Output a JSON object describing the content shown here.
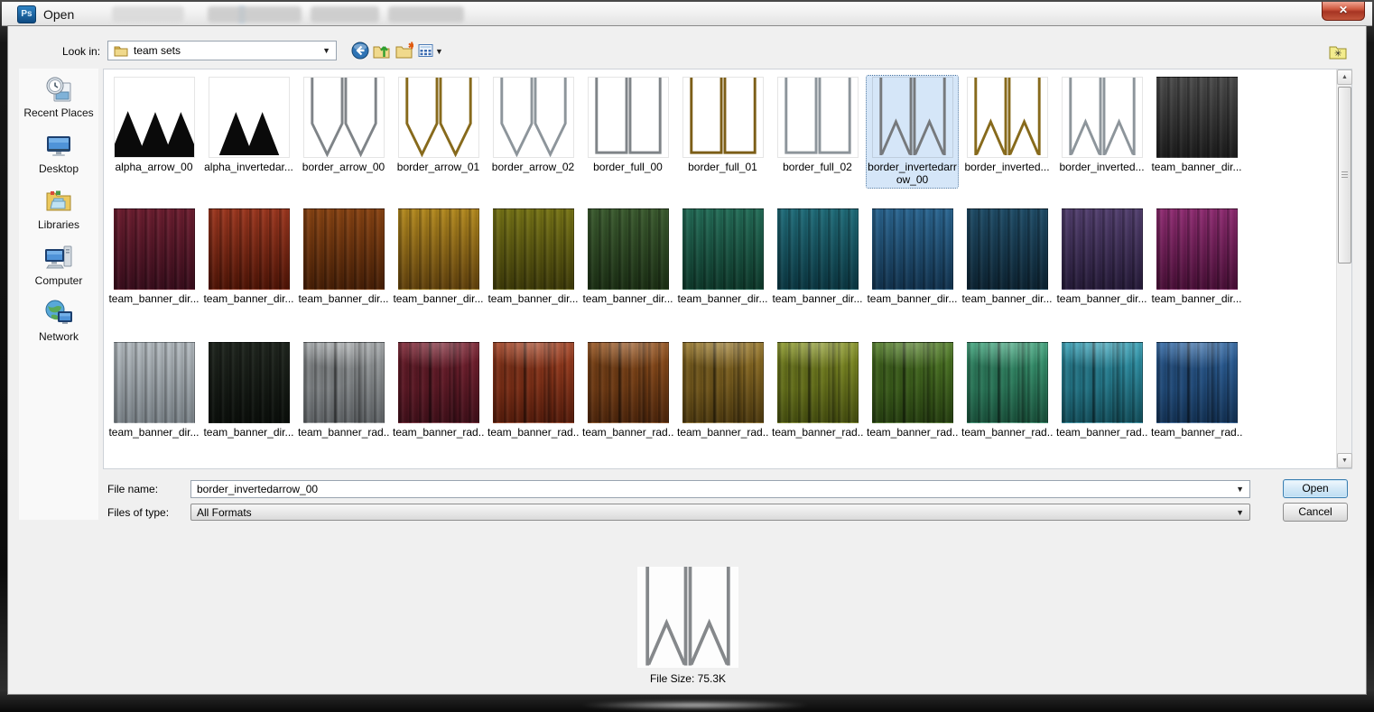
{
  "window": {
    "app_badge": "Ps",
    "title": "Open",
    "close_glyph": "✕"
  },
  "toolbar": {
    "look_in_label": "Look in:",
    "look_in_value": "team sets",
    "caret": "▼",
    "icons": [
      "back-icon",
      "up-one-level-icon",
      "new-folder-icon",
      "view-menu-icon",
      "favorites-icon"
    ]
  },
  "places": {
    "items": [
      "Recent Places",
      "Desktop",
      "Libraries",
      "Computer",
      "Network"
    ],
    "icons": [
      "recent-places-icon",
      "desktop-icon",
      "libraries-icon",
      "computer-icon",
      "network-icon"
    ]
  },
  "file_grid": {
    "rows": [
      {
        "items": [
          {
            "label": "alpha_arrow_00",
            "kind": "alpha3",
            "color": "#0a0a0a"
          },
          {
            "label": "alpha_invertedar...",
            "kind": "alpha2",
            "color": "#0a0a0a"
          },
          {
            "label": "border_arrow_00",
            "kind": "w",
            "color": "#7f8488"
          },
          {
            "label": "border_arrow_01",
            "kind": "w",
            "color": "#876a1c"
          },
          {
            "label": "border_arrow_02",
            "kind": "w",
            "color": "#8d959b"
          },
          {
            "label": "border_full_00",
            "kind": "u",
            "color": "#7f8488"
          },
          {
            "label": "border_full_01",
            "kind": "u",
            "color": "#7c5e17"
          },
          {
            "label": "border_full_02",
            "kind": "u",
            "color": "#8d959b"
          },
          {
            "label": "border_invertedarrow_00",
            "kind": "m",
            "color": "#76797c",
            "selected": true
          },
          {
            "label": "border_inverted...",
            "kind": "m",
            "color": "#876a1c"
          },
          {
            "label": "border_inverted...",
            "kind": "m",
            "color": "#8d959b"
          },
          {
            "label": "team_banner_dir...",
            "kind": "curtain-dir",
            "c1": "#4d4d4d",
            "c2": "#1d1d1d"
          }
        ]
      },
      {
        "items": [
          {
            "label": "team_banner_dir...",
            "kind": "curtain-dir",
            "c1": "#6e1f31",
            "c2": "#3a0e1d"
          },
          {
            "label": "team_banner_dir...",
            "kind": "curtain-dir",
            "c1": "#9c3820",
            "c2": "#501507"
          },
          {
            "label": "team_banner_dir...",
            "kind": "curtain-dir",
            "c1": "#8a4514",
            "c2": "#482007"
          },
          {
            "label": "team_banner_dir...",
            "kind": "curtain-dir",
            "c1": "#b38a20",
            "c2": "#63430e"
          },
          {
            "label": "team_banner_dir...",
            "kind": "curtain-dir",
            "c1": "#787517",
            "c2": "#3f3c0a"
          },
          {
            "label": "team_banner_dir...",
            "kind": "curtain-dir",
            "c1": "#3c5c30",
            "c2": "#1c3015"
          },
          {
            "label": "team_banner_dir...",
            "kind": "curtain-dir",
            "c1": "#256e59",
            "c2": "#0f3a2c"
          },
          {
            "label": "team_banner_dir...",
            "kind": "curtain-dir",
            "c1": "#216d7a",
            "c2": "#0c3843"
          },
          {
            "label": "team_banner_dir...",
            "kind": "curtain-dir",
            "c1": "#2c6792",
            "c2": "#133450"
          },
          {
            "label": "team_banner_dir...",
            "kind": "curtain-dir",
            "c1": "#204d68",
            "c2": "#0d2433"
          },
          {
            "label": "team_banner_dir...",
            "kind": "curtain-dir",
            "c1": "#53406f",
            "c2": "#271c3a"
          },
          {
            "label": "team_banner_dir...",
            "kind": "curtain-dir",
            "c1": "#8f2d72",
            "c2": "#4a1038"
          }
        ]
      },
      {
        "items": [
          {
            "label": "team_banner_dir...",
            "kind": "curtain-dir",
            "c1": "#b6bdc2",
            "c2": "#7e868c"
          },
          {
            "label": "team_banner_dir...",
            "kind": "curtain-dir",
            "c1": "#20261f",
            "c2": "#0b0f0b"
          },
          {
            "label": "team_banner_rad...",
            "kind": "curtain-rad",
            "c1": "#a2a6a8",
            "c2": "#626669"
          },
          {
            "label": "team_banner_rad...",
            "kind": "curtain-rad",
            "c1": "#7c2433",
            "c2": "#41101a"
          },
          {
            "label": "team_banner_rad...",
            "kind": "curtain-rad",
            "c1": "#a54323",
            "c2": "#571d0c"
          },
          {
            "label": "team_banner_rad...",
            "kind": "curtain-rad",
            "c1": "#96541f",
            "c2": "#4e260c"
          },
          {
            "label": "team_banner_rad...",
            "kind": "curtain-rad",
            "c1": "#99782a",
            "c2": "#4f3b10"
          },
          {
            "label": "team_banner_rad...",
            "kind": "curtain-rad",
            "c1": "#8a9729",
            "c2": "#464f10"
          },
          {
            "label": "team_banner_rad...",
            "kind": "curtain-rad",
            "c1": "#537f28",
            "c2": "#274011"
          },
          {
            "label": "team_banner_rad...",
            "kind": "curtain-rad",
            "c1": "#3fa37b",
            "c2": "#1a523c"
          },
          {
            "label": "team_banner_rad...",
            "kind": "curtain-rad",
            "c1": "#36a0b6",
            "c2": "#14505d"
          },
          {
            "label": "team_banner_rad...",
            "kind": "curtain-rad",
            "c1": "#3268a4",
            "c2": "#143356"
          }
        ]
      }
    ]
  },
  "fields": {
    "file_name_label": "File name:",
    "file_name_value": "border_invertedarrow_00",
    "files_of_type_label": "Files of type:",
    "files_of_type_value": "All Formats"
  },
  "buttons": {
    "open": "Open",
    "cancel": "Cancel"
  },
  "preview": {
    "kind": "m",
    "color": "#85888b",
    "caption": "File Size: 75.3K"
  },
  "colors": {
    "selection_fill": "#d5e6f8",
    "selection_border": "#36689c",
    "default_button_border": "#3c7fb1"
  }
}
